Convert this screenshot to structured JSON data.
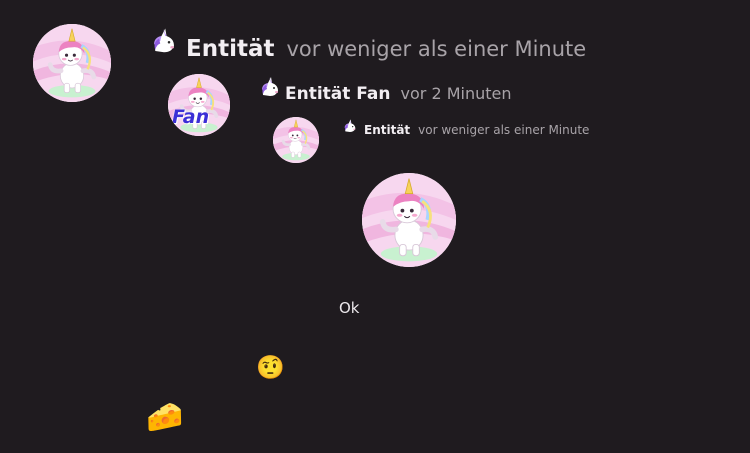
{
  "posts": [
    {
      "icon": "unicorn-emoji",
      "name": "Entität",
      "time": "vor weniger als einer Minute"
    },
    {
      "icon": "unicorn-emoji",
      "name": "Entität Fan",
      "time": "vor 2 Minuten",
      "avatar_badge": "Fan"
    },
    {
      "icon": "unicorn-emoji",
      "name": "Entität",
      "time": "vor weniger als einer Minute"
    }
  ],
  "messages": {
    "text": "Ok",
    "emoji_face": "🤨",
    "emoji_cheese": "🧀"
  },
  "colors": {
    "background": "#1f1b1f",
    "text": "#ece8ec",
    "muted": "#a8a3a8",
    "badge": "#3b2fd6"
  }
}
